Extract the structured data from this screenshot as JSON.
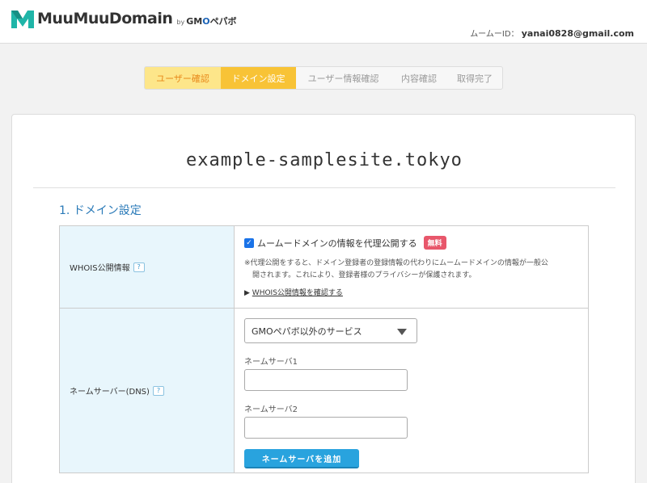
{
  "brand": {
    "name": "MuuMuuDomain",
    "by": "by",
    "gmo_prefix": "GM",
    "gmo_o": "O",
    "gmo_suffix": "ペパボ",
    "accent": "#2a7ab8"
  },
  "user": {
    "label": "ムームーID：",
    "id": "yanai0828@gmail.com"
  },
  "steps": [
    {
      "label": "ユーザー確認",
      "state": "done"
    },
    {
      "label": "ドメイン設定",
      "state": "current"
    },
    {
      "label": "ユーザー情報確認",
      "state": "todo"
    },
    {
      "label": "内容確認",
      "state": "todo"
    },
    {
      "label": "取得完了",
      "state": "todo"
    }
  ],
  "domain": "example-samplesite.tokyo",
  "section": {
    "title": "1. ドメイン設定"
  },
  "whois": {
    "label": "WHOIS公開情報",
    "help": "?",
    "checkbox_label": "ムームードメインの情報を代理公開する",
    "checked": true,
    "badge": "無料",
    "note_line1": "※代理公開をすると、ドメイン登録者の登録情報の代わりにムームードメインの情報が一般公",
    "note_line2": "開されます。これにより、登録者様のプライバシーが保護されます。",
    "link_prefix": "▶",
    "link": "WHOIS公開情報を確認する"
  },
  "dns": {
    "label": "ネームサーバー(DNS)",
    "help": "?",
    "select_value": "GMOペパボ以外のサービス",
    "ns1_label": "ネームサーバ1",
    "ns1_value": "",
    "ns2_label": "ネームサーバ2",
    "ns2_value": "",
    "add_button": "ネームサーバを追加"
  }
}
